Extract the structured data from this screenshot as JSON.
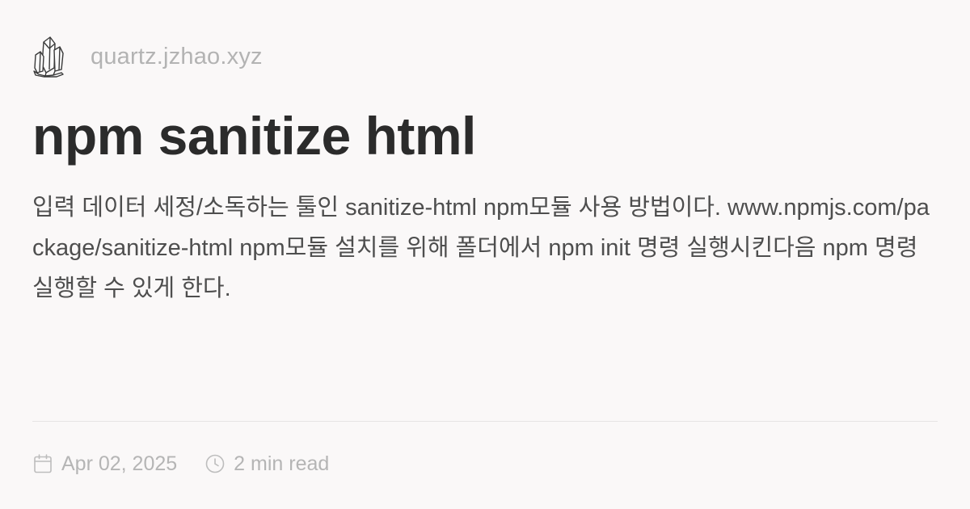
{
  "site": {
    "name": "quartz.jzhao.xyz",
    "logo_icon": "crystal-icon"
  },
  "page": {
    "title": "npm sanitize html",
    "description": "입력 데이터 세정/소독하는 툴인 sanitize-html npm모듈 사용 방법이다. www.npmjs.com/package/sanitize-html npm모듈 설치를 위해 폴더에서 npm init 명령 실행시킨다음 npm 명령 실행할 수 있게 한다."
  },
  "meta": {
    "date": "Apr 02, 2025",
    "date_icon": "calendar-icon",
    "reading_time": "2 min read",
    "reading_icon": "clock-icon"
  },
  "colors": {
    "background": "#faf8f8",
    "title": "#2b2b2b",
    "body": "#4e4e4e",
    "muted": "#b3b3b3"
  }
}
